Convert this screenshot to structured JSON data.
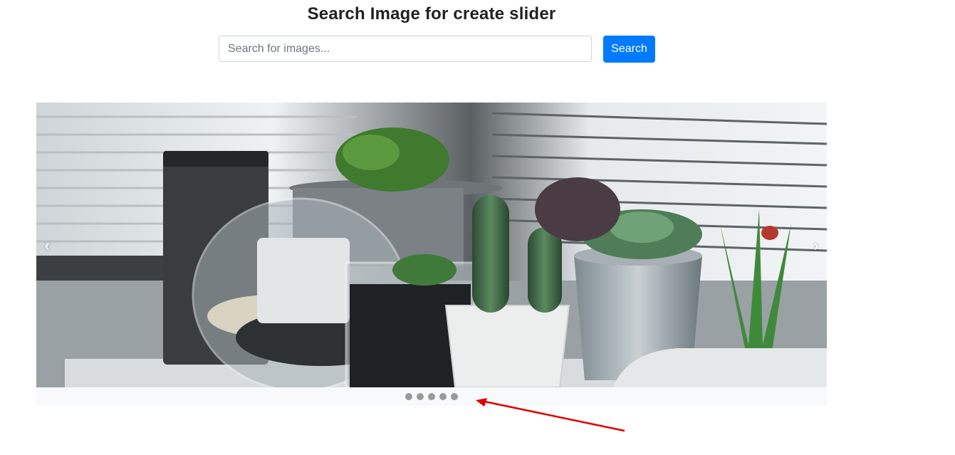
{
  "page": {
    "title": "Search Image for create slider"
  },
  "search": {
    "placeholder": "Search for images...",
    "value": "",
    "button_label": "Search"
  },
  "slider": {
    "image_description_icon": "cactus-plants-photo",
    "prev_icon": "chevron-left-icon",
    "next_icon": "chevron-right-icon",
    "prev_glyph": "‹",
    "next_glyph": "›",
    "dot_count": 5,
    "dot_color": "#999999",
    "dots_bar_color": "#f8f9fa"
  },
  "annotation": {
    "arrow_color": "#e00000"
  },
  "colors": {
    "primary": "#007bff",
    "title_text": "#222222"
  }
}
